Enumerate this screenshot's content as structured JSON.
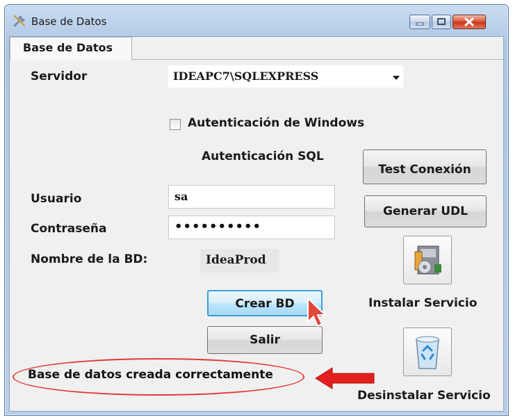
{
  "window": {
    "title": "Base de Datos"
  },
  "tabs": [
    {
      "label": "Base de Datos"
    }
  ],
  "form": {
    "server_label": "Servidor",
    "server_value": "IDEAPC7\\SQLEXPRESS",
    "windows_auth_label": "Autenticación de Windows",
    "windows_auth_checked": false,
    "sql_auth_heading": "Autenticación SQL",
    "user_label": "Usuario",
    "user_value": "sa",
    "password_label": "Contraseña",
    "password_value": "••••••••••",
    "db_name_label": "Nombre de la BD:",
    "db_name_value": "IdeaProd"
  },
  "buttons": {
    "test_connection": "Test Conexión",
    "generate_udl": "Generar UDL",
    "create_db": "Crear BD",
    "exit": "Salir",
    "install_service": "Instalar Servicio",
    "uninstall_service": "Desinstalar Servicio"
  },
  "status": {
    "message": "Base de datos creada correctamente"
  },
  "icons": {
    "app": "tools-icon",
    "install": "installer-icon",
    "uninstall": "recycle-bin-icon",
    "annotation": "red-arrow-icon",
    "cursor": "mouse-pointer-icon"
  },
  "colors": {
    "window_frame": "#b9cfe8",
    "client_background": "#f0f0f0",
    "close_button": "#c8321a",
    "annotation": "#e03a3a",
    "focused_button_border": "#3c9ddd"
  }
}
